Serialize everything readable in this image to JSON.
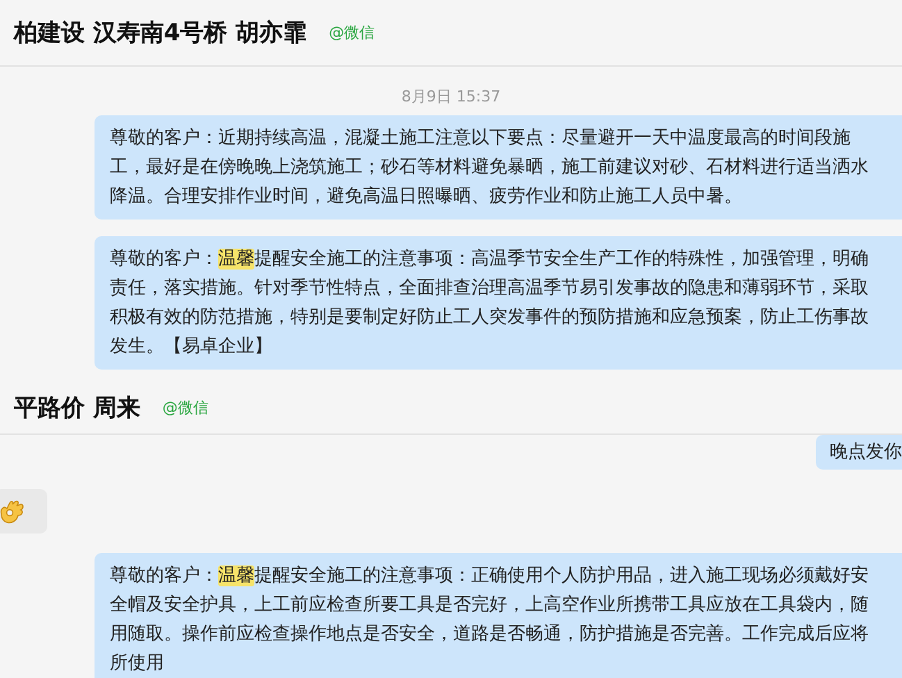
{
  "header": {
    "title": "柏建设 汉寿南4号桥 胡亦霏",
    "source": "@微信"
  },
  "timestamp": "8月9日 15:37",
  "messages": [
    {
      "outgoing": true,
      "parts": [
        {
          "text": "尊敬的客户：近期持续高温，混凝土施工注意以下要点：尽量避开一天中温度最高的时间段施工，最好是在傍晚晚上浇筑施工；砂石等材料避免暴晒，施工前建议对砂、石材料进行适当洒水降温。合理安排作业时间，避免高温日照曝晒、疲劳作业和防止施工人员中暑。",
          "highlight": false
        }
      ]
    },
    {
      "outgoing": true,
      "parts": [
        {
          "text": "尊敬的客户：",
          "highlight": false
        },
        {
          "text": "温馨",
          "highlight": true
        },
        {
          "text": "提醒安全施工的注意事项：高温季节安全生产工作的特殊性，加强管理，明确责任，落实措施。针对季节性特点，全面排查治理高温季节易引发事故的隐患和薄弱环节，采取积极有效的防范措施，特别是要制定好防止工人突发事件的预防措施和应急预案，防止工伤事故发生。【易卓企业】",
          "highlight": false
        }
      ]
    }
  ],
  "header2": {
    "title": "平路价 周来",
    "source": "@微信"
  },
  "messages2": [
    {
      "outgoing": true,
      "kind": "text",
      "parts": [
        {
          "text": "晚点发你",
          "highlight": false
        }
      ]
    },
    {
      "outgoing": false,
      "kind": "emoji"
    },
    {
      "outgoing": true,
      "kind": "text",
      "parts": [
        {
          "text": "尊敬的客户：",
          "highlight": false
        },
        {
          "text": "温馨",
          "highlight": true
        },
        {
          "text": "提醒安全施工的注意事项：正确使用个人防护用品，进入施工现场必须戴好安全帽及安全护具，上工前应检查所要工具是否完好，上高空作业所携带工具应放在工具袋内，随用随取。操作前应检查操作地点是否安全，道路是否畅通，防护措施是否完善。工作完成后应将所使用",
          "highlight": false
        }
      ]
    }
  ]
}
